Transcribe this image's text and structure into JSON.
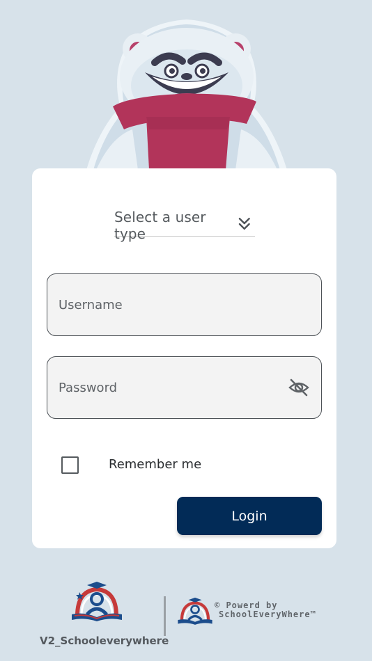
{
  "login_form": {
    "user_type_label": "Select a user type",
    "username_placeholder": "Username",
    "password_placeholder": "Password",
    "remember_label": "Remember me",
    "login_label": "Login"
  },
  "footer": {
    "app_version": "V2_Schooleverywhere",
    "powered_line1": "© Powerd by",
    "powered_line2": "SchoolEveryWhere™"
  },
  "colors": {
    "background": "#d7e2ea",
    "card": "#ffffff",
    "primary": "#022b57",
    "field_bg": "#f3f3f3",
    "mascot_scarf": "#b2345a"
  },
  "icons": {
    "user_type_chevron": "double-chevron-down-icon",
    "password_toggle": "eye-slash-icon",
    "mascot": "polar-bear-mascot",
    "brand": "school-everywhere-logo"
  }
}
